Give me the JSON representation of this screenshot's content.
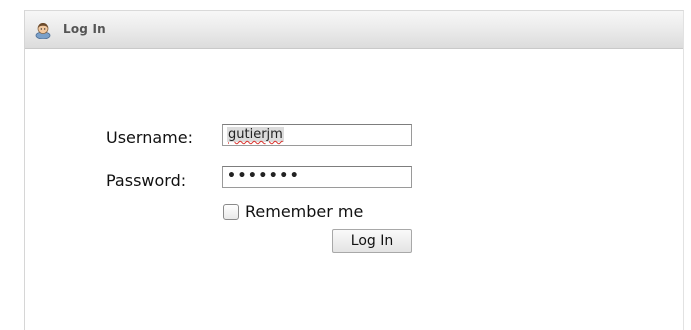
{
  "panel": {
    "title": "Log In",
    "icon": "user-icon"
  },
  "form": {
    "username_label": "Username:",
    "username_value": "gutierjm",
    "password_label": "Password:",
    "password_value": "•••••••",
    "remember_label": "Remember me",
    "remember_checked": false,
    "submit_label": "Log In"
  }
}
